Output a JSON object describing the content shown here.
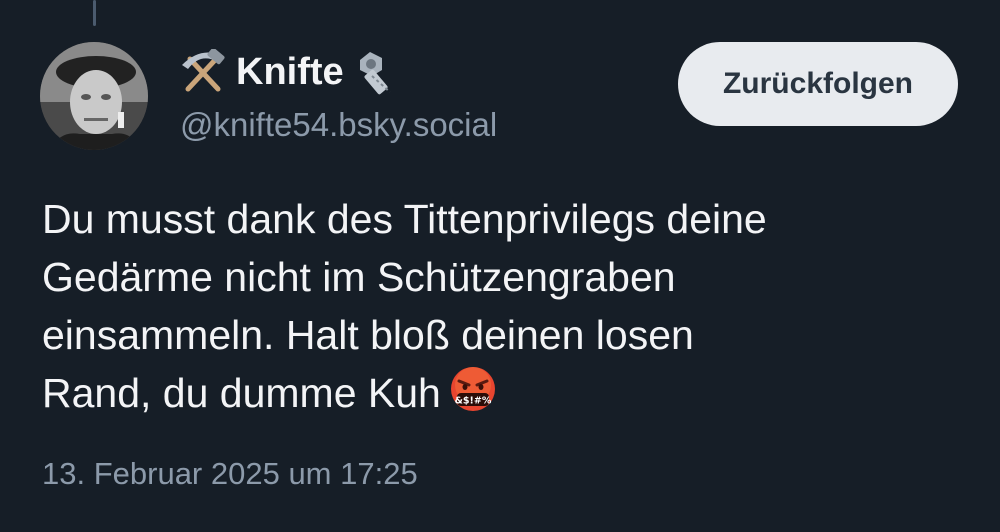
{
  "post": {
    "author": {
      "display_name": "Knifte",
      "handle": "@knifte54.bsky.social",
      "name_prefix_icon": "hammer-and-pick-icon",
      "name_suffix_icon": "nut-and-bolt-icon"
    },
    "follow_button_label": "Zurückfolgen",
    "text_lines": [
      "Du musst dank des Tittenprivilegs deine",
      "Gedärme nicht im Schützengraben",
      "einsammeln. Halt bloß deinen losen",
      "Rand, du dumme Kuh"
    ],
    "trailing_emoji": "face-with-symbols-on-mouth-icon",
    "emoji_symbols": "&$!#%",
    "timestamp": "13. Februar 2025 um 17:25"
  },
  "colors": {
    "background": "#161e27",
    "handle_gray": "#8c9aaa",
    "button_bg": "#e8ebef"
  }
}
